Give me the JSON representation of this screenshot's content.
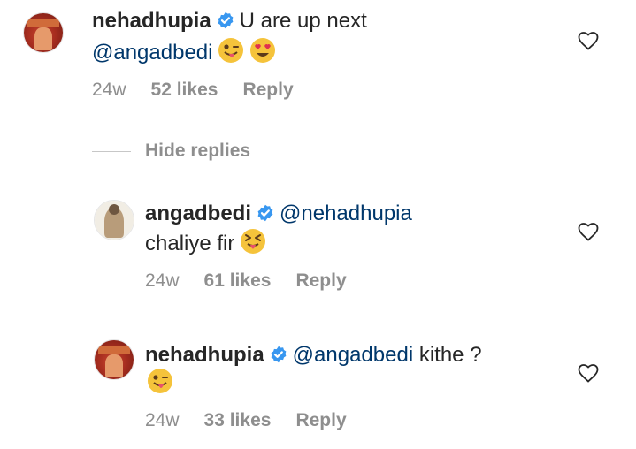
{
  "comments": [
    {
      "username": "nehadhupia",
      "text_parts": [
        "U are up next"
      ],
      "mention_line2": "@angadbedi",
      "emojis": [
        "winking-tongue-emoji",
        "heart-eyes-emoji"
      ],
      "age": "24w",
      "likes": "52 likes",
      "reply": "Reply",
      "avatar": "magazine-cover-avatar"
    },
    {
      "username": "angadbedi",
      "mention": "@nehadhupia",
      "text": "chaliye fir",
      "emojis": [
        "squinting-tongue-emoji"
      ],
      "age": "24w",
      "likes": "61 likes",
      "reply": "Reply",
      "avatar": "man-photo-avatar"
    },
    {
      "username": "nehadhupia",
      "mention": "@angadbedi",
      "text": "kithe ?",
      "emojis": [
        "winking-tongue-emoji"
      ],
      "age": "24w",
      "likes": "33 likes",
      "reply": "Reply",
      "avatar": "magazine-cover-avatar"
    }
  ],
  "hide_replies": "Hide replies",
  "colors": {
    "username": "#262626",
    "mention": "#00376b",
    "meta": "#8e8e8e",
    "verified": "#3897f0"
  }
}
